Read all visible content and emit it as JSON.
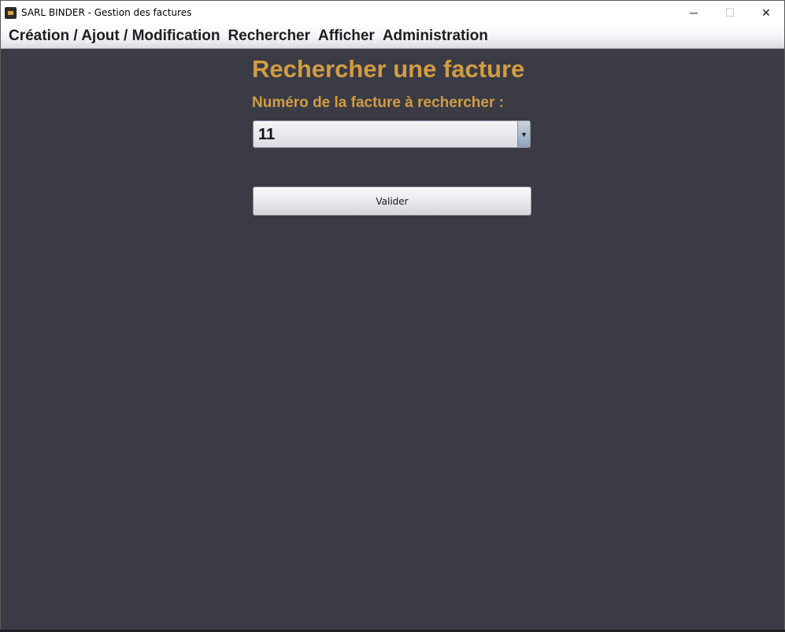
{
  "window": {
    "title": "SARL BINDER - Gestion des factures",
    "controls": {
      "minimize": "─",
      "maximize": "☐",
      "close": "✕"
    }
  },
  "menubar": {
    "items": [
      {
        "label": "Création / Ajout / Modification"
      },
      {
        "label": "Rechercher"
      },
      {
        "label": "Afficher"
      },
      {
        "label": "Administration"
      }
    ]
  },
  "main": {
    "title": "Rechercher une facture",
    "invoice_label": "Numéro de la facture à rechercher :",
    "invoice_select": {
      "value": "11",
      "arrow": "▼"
    },
    "submit_label": "Valider"
  },
  "colors": {
    "background": "#3a3b45",
    "accent": "#d39c42"
  }
}
